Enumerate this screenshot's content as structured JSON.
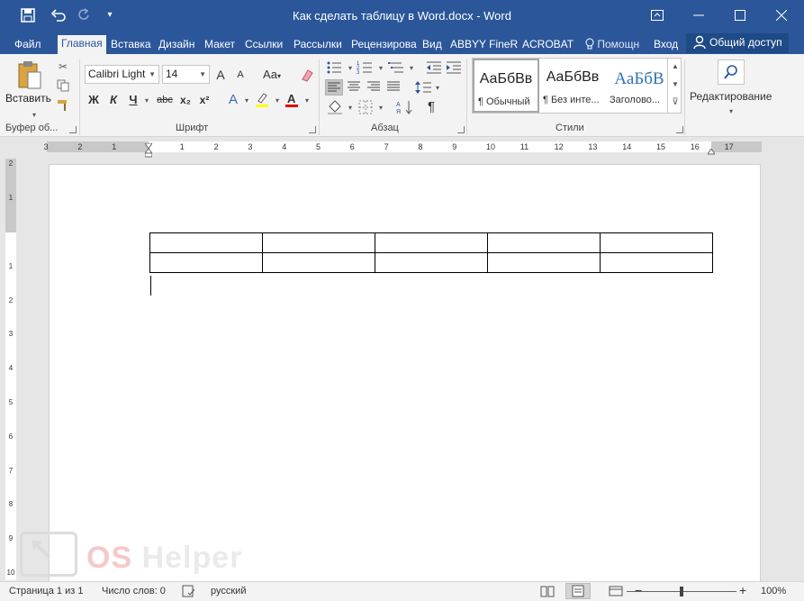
{
  "titlebar": {
    "title": "Как сделать таблицу в Word.docx - Word",
    "icons": [
      "save-icon",
      "undo-icon",
      "redo-icon",
      "customize-qat-icon",
      "ribbon-display-icon",
      "minimize-icon",
      "maximize-icon",
      "close-icon"
    ]
  },
  "tabs": [
    "Файл",
    "Главная",
    "Вставка",
    "Дизайн",
    "Макет",
    "Ссылки",
    "Рассылки",
    "Рецензирова",
    "Вид",
    "ABBYY FineR",
    "ACROBAT"
  ],
  "active_tab": "Главная",
  "tell_me": "Помощн",
  "signin": "Вход",
  "share": "Общий доступ",
  "clipboard": {
    "paste": "Вставить",
    "label": "Буфер об..."
  },
  "font": {
    "name": "Calibri Light",
    "size": "14",
    "grow": "A",
    "shrink": "A",
    "case": "Aa",
    "bold": "Ж",
    "italic": "К",
    "underline": "Ч",
    "strike": "abc",
    "sub": "x₂",
    "sup": "x²",
    "label": "Шрифт",
    "highlight_color": "#ffff00",
    "font_color": "#e00000"
  },
  "paragraph": {
    "label": "Абзац",
    "pilcrow": "¶"
  },
  "styles": {
    "items": [
      {
        "sample": "АаБбВв",
        "name": "¶ Обычный"
      },
      {
        "sample": "АаБбВв",
        "name": "¶ Без инте..."
      },
      {
        "sample": "АаБбВ",
        "name": "Заголово..."
      }
    ],
    "label": "Стили"
  },
  "editing": {
    "label": "Редактирование"
  },
  "ruler": {
    "numbers": [
      "3",
      "2",
      "1",
      "1",
      "2",
      "3",
      "4",
      "5",
      "6",
      "7",
      "8",
      "9",
      "10",
      "11",
      "12",
      "13",
      "14",
      "15",
      "16",
      "17"
    ],
    "v_numbers": [
      "2",
      "1",
      "1",
      "2",
      "3",
      "4",
      "5",
      "6",
      "7",
      "8",
      "9",
      "10"
    ]
  },
  "document": {
    "table": {
      "rows": 2,
      "cols": 5
    }
  },
  "watermark": {
    "os": "OS",
    "rest": " Helper"
  },
  "statusbar": {
    "page": "Страница 1 из 1",
    "words": "Число слов: 0",
    "language": "русский",
    "zoom": "100%",
    "zoom_level": 1.0
  },
  "colors": {
    "accent": "#2b579a",
    "ribbon": "#f3f3f3"
  }
}
